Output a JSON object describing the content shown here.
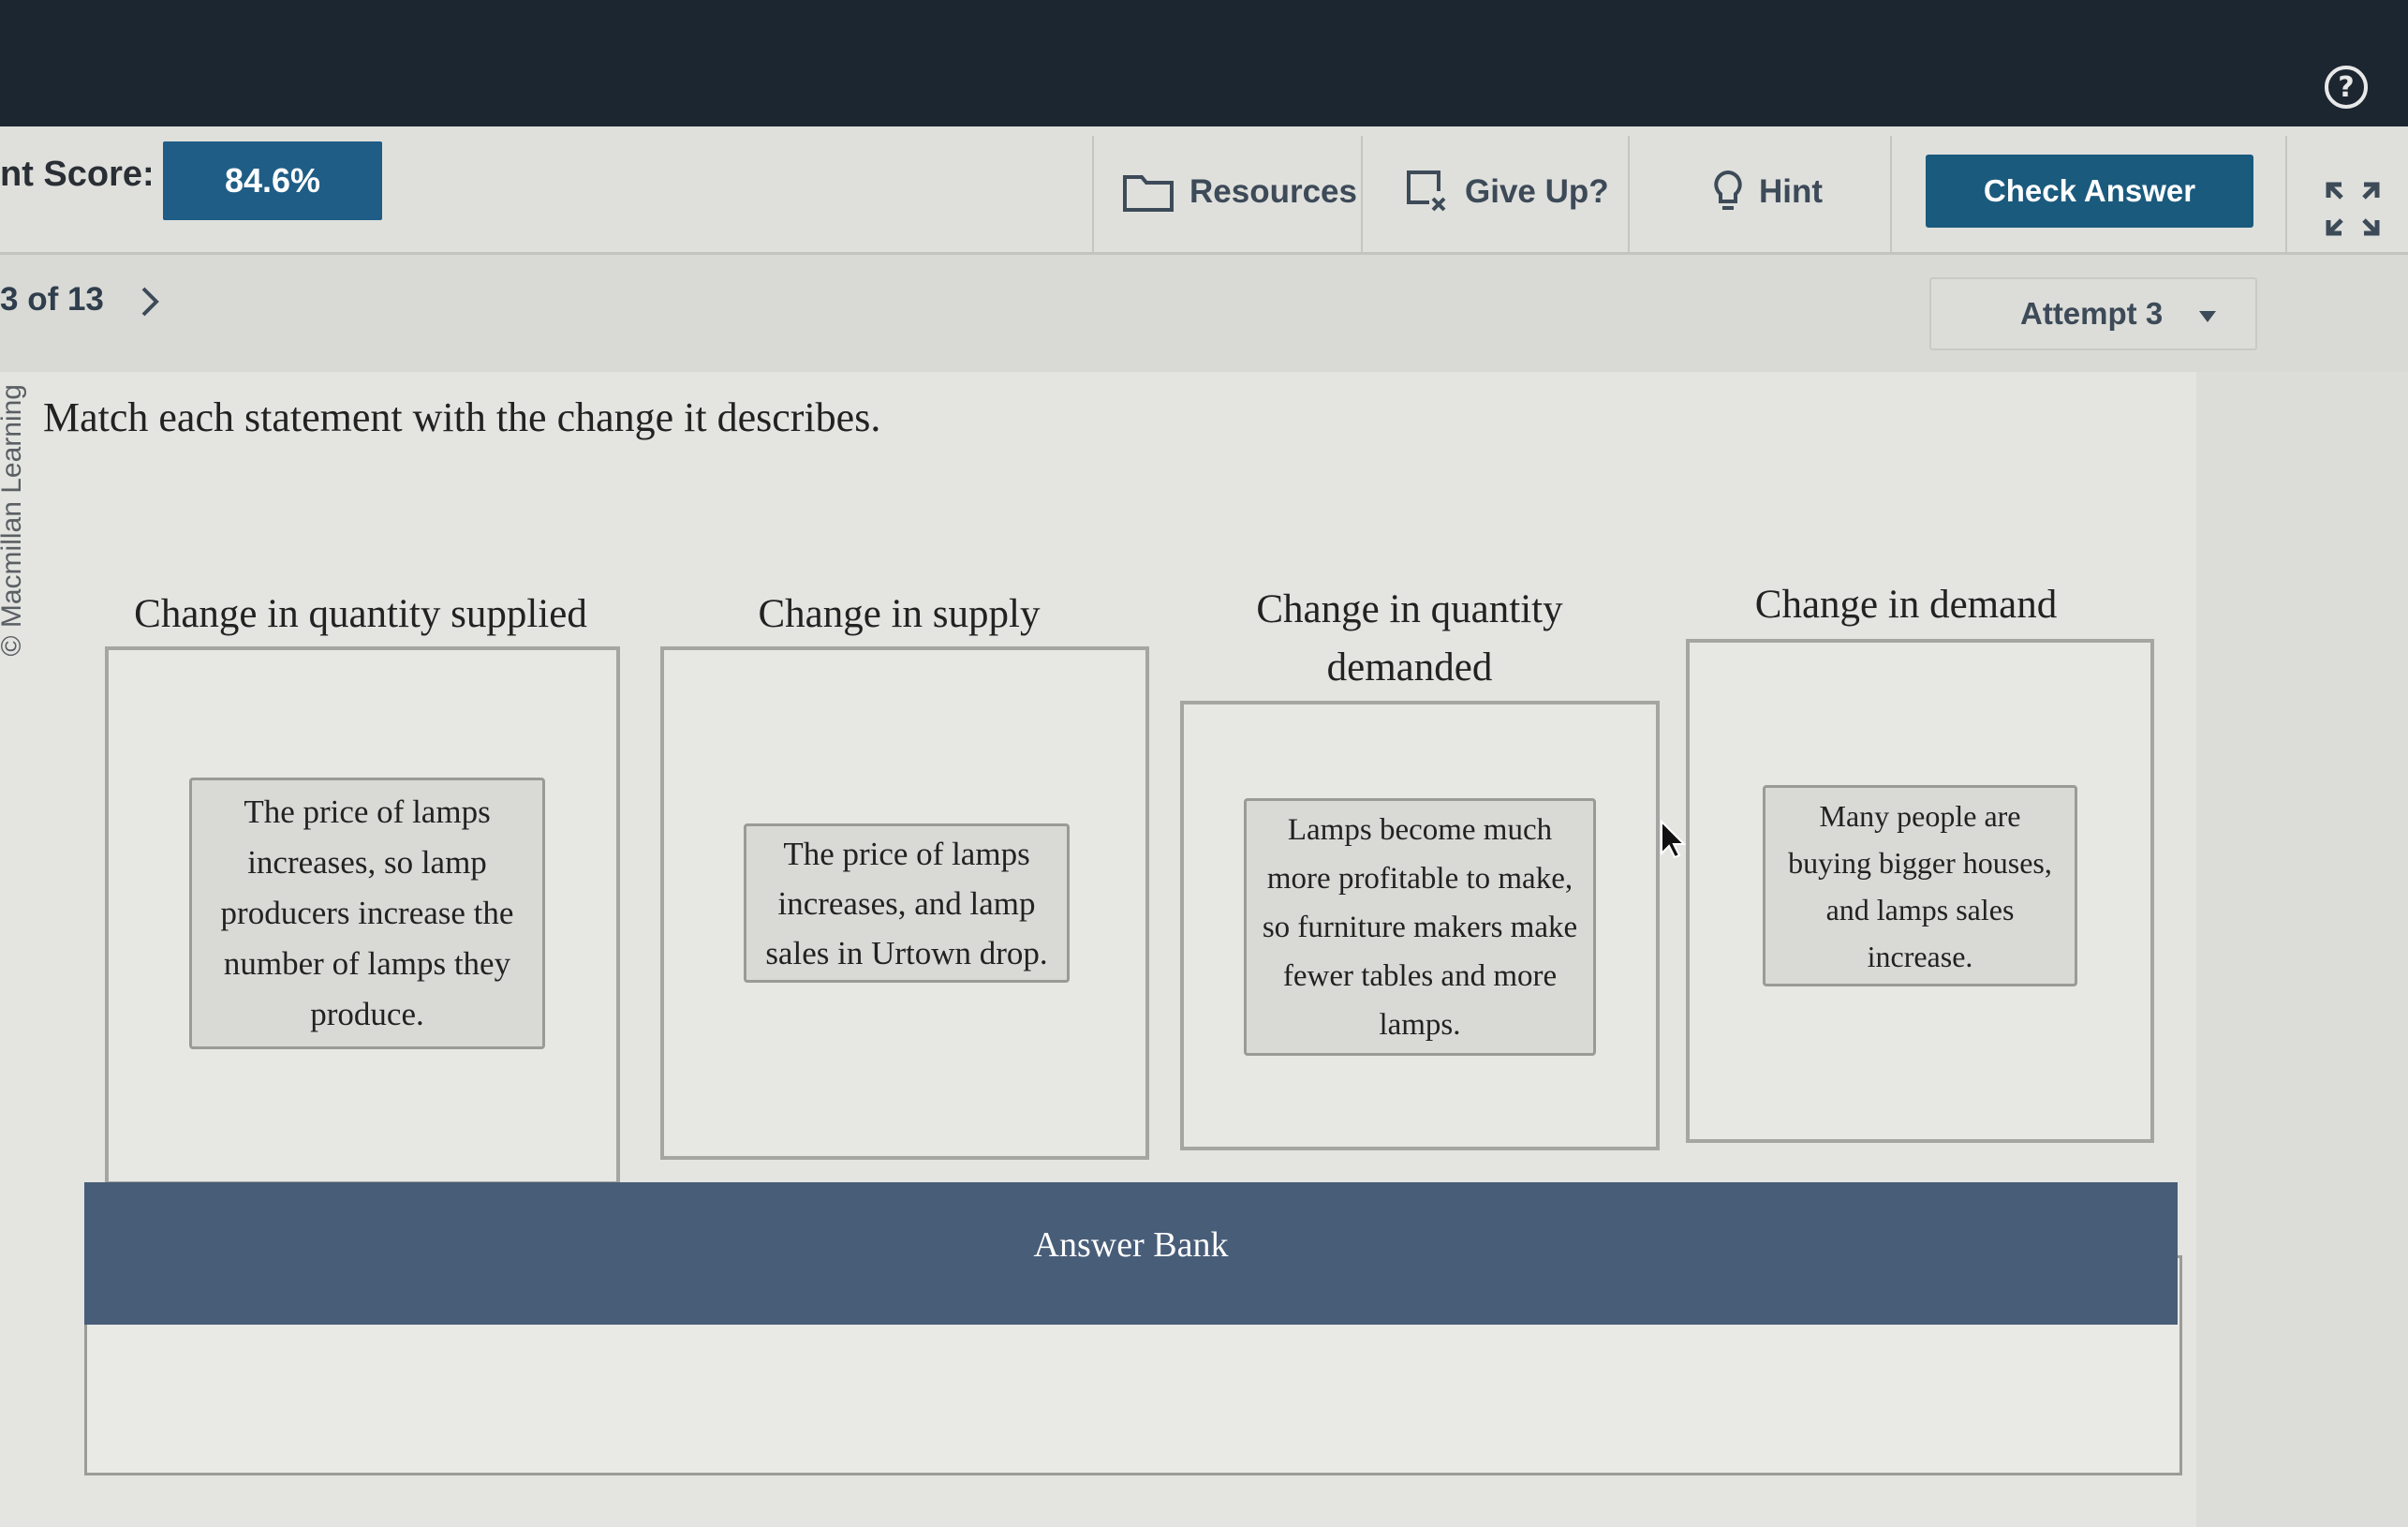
{
  "toolbar": {
    "score_label": "nt Score:",
    "score_value": "84.6%",
    "resources_label": "Resources",
    "giveup_label": "Give Up?",
    "hint_label": "Hint",
    "check_label": "Check Answer",
    "icons": [
      "folder-icon",
      "give-up-icon",
      "lightbulb-icon",
      "expand-icon",
      "help-icon"
    ]
  },
  "nav": {
    "page_count": "3 of 13",
    "attempt_label": "Attempt 3"
  },
  "copyright": "© Macmillan Learning",
  "question": {
    "instruction": "Match each statement with the change it describes."
  },
  "categories": [
    {
      "title": "Change in quantity supplied",
      "card": "The price of lamps increases, so lamp producers increase the number of lamps they produce."
    },
    {
      "title": "Change in supply",
      "card": "The price of lamps increases, and lamp sales in Urtown drop."
    },
    {
      "title": "Change in quantity demanded",
      "card": "Lamps become much more profitable to make, so furniture makers make fewer tables and more lamps."
    },
    {
      "title": "Change in demand",
      "card": "Many people are buying bigger houses, and lamps sales increase."
    }
  ],
  "answer_bank": {
    "title": "Answer Bank"
  },
  "colors": {
    "topbar": "#1c2631",
    "accent": "#1f5d86",
    "check_button": "#1a5a7d",
    "answer_bank_header": "#485d78"
  }
}
